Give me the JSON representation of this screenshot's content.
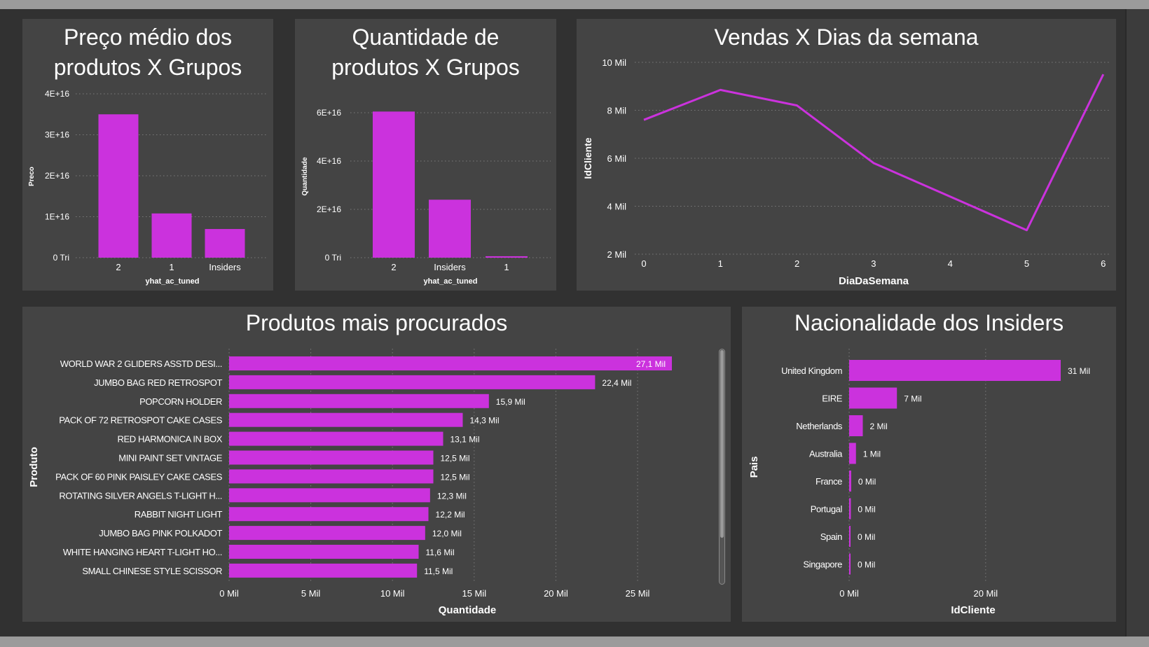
{
  "colors": {
    "accent": "#cb32dd",
    "background": "#313131",
    "panel": "#444444",
    "text": "#ffffff",
    "grid": "#7a7a7a"
  },
  "charts": {
    "preco": {
      "title": "Preço médio dos\nprodutos X Grupos",
      "xlabel": "yhat_ac_tuned",
      "ylabel": "Preco",
      "ytick_labels": [
        "0 Tri",
        "1E+16",
        "2E+16",
        "3E+16",
        "4E+16"
      ]
    },
    "quantidade": {
      "title": "Quantidade de\nprodutos X Grupos",
      "xlabel": "yhat_ac_tuned",
      "ylabel": "Quantidade",
      "ytick_labels": [
        "0 Tri",
        "2E+16",
        "4E+16",
        "6E+16"
      ]
    },
    "vendas": {
      "title": "Vendas X Dias da semana",
      "xlabel": "DiaDaSemana",
      "ylabel": "IdCliente",
      "ytick_labels": [
        "2 Mil",
        "4 Mil",
        "6 Mil",
        "8 Mil",
        "10 Mil"
      ]
    },
    "produtos": {
      "title": "Produtos mais procurados",
      "xlabel": "Quantidade",
      "ylabel": "Produto",
      "xtick_labels": [
        "0 Mil",
        "5 Mil",
        "10 Mil",
        "15 Mil",
        "20 Mil",
        "25 Mil"
      ],
      "data_labels": [
        "27,1 Mil",
        "22,4 Mil",
        "15,9 Mil",
        "14,3 Mil",
        "13,1 Mil",
        "12,5 Mil",
        "12,5 Mil",
        "12,3 Mil",
        "12,2 Mil",
        "12,0 Mil",
        "11,6 Mil",
        "11,5 Mil"
      ]
    },
    "nacionalidade": {
      "title": "Nacionalidade dos Insiders",
      "xlabel": "IdCliente",
      "ylabel": "Pais",
      "xtick_labels": [
        "0 Mil",
        "20 Mil"
      ],
      "data_labels": [
        "31 Mil",
        "7 Mil",
        "2 Mil",
        "1 Mil",
        "0 Mil",
        "0 Mil",
        "0 Mil",
        "0 Mil"
      ]
    }
  },
  "chart_data": [
    {
      "type": "bar",
      "title": "Preço médio dos produtos X Grupos",
      "xlabel": "yhat_ac_tuned",
      "ylabel": "Preco",
      "categories": [
        "2",
        "1",
        "Insiders"
      ],
      "values": [
        3.5e+16,
        1.08e+16,
        7000000000000000.0
      ],
      "ylim": [
        0,
        4e+16
      ],
      "grid": true
    },
    {
      "type": "bar",
      "title": "Quantidade de produtos X Grupos",
      "xlabel": "yhat_ac_tuned",
      "ylabel": "Quantidade",
      "categories": [
        "2",
        "Insiders",
        "1"
      ],
      "values": [
        6.05e+16,
        2.4e+16,
        600000000000000.0
      ],
      "ylim": [
        0,
        6.5e+16
      ],
      "grid": true
    },
    {
      "type": "line",
      "title": "Vendas X Dias da semana",
      "xlabel": "DiaDaSemana",
      "ylabel": "IdCliente",
      "x": [
        0,
        1,
        2,
        3,
        4,
        5,
        6
      ],
      "values": [
        7600,
        8850,
        8200,
        5800,
        4400,
        3000,
        9500
      ],
      "ylim": [
        2000,
        10000
      ],
      "grid": true
    },
    {
      "type": "bar",
      "orientation": "horizontal",
      "title": "Produtos mais procurados",
      "xlabel": "Quantidade",
      "ylabel": "Produto",
      "categories": [
        "WORLD WAR 2 GLIDERS ASSTD DESI...",
        "JUMBO BAG RED RETROSPOT",
        "POPCORN HOLDER",
        "PACK OF 72 RETROSPOT CAKE CASES",
        "RED HARMONICA IN BOX",
        "MINI PAINT SET VINTAGE",
        "PACK OF 60 PINK PAISLEY CAKE CASES",
        "ROTATING SILVER ANGELS T-LIGHT H...",
        "RABBIT NIGHT LIGHT",
        "JUMBO BAG PINK POLKADOT",
        "WHITE HANGING HEART T-LIGHT HO...",
        "SMALL CHINESE STYLE SCISSOR"
      ],
      "values": [
        27100,
        22400,
        15900,
        14300,
        13100,
        12500,
        12500,
        12300,
        12200,
        12000,
        11600,
        11500
      ],
      "xlim": [
        0,
        28000
      ],
      "grid": true
    },
    {
      "type": "bar",
      "orientation": "horizontal",
      "title": "Nacionalidade dos Insiders",
      "xlabel": "IdCliente",
      "ylabel": "Pais",
      "categories": [
        "United Kingdom",
        "EIRE",
        "Netherlands",
        "Australia",
        "France",
        "Portugal",
        "Spain",
        "Singapore"
      ],
      "values": [
        31000,
        7000,
        2000,
        1000,
        300,
        250,
        200,
        100
      ],
      "xlim": [
        0,
        35000
      ],
      "grid": true
    }
  ]
}
